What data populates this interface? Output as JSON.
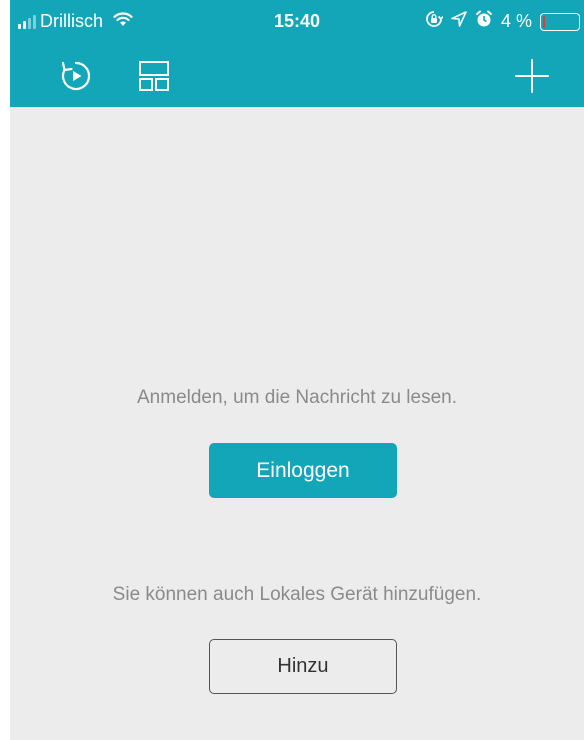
{
  "status_bar": {
    "carrier": "Drillisch",
    "time": "15:40",
    "battery_percent": "4 %",
    "battery_level": 0.04,
    "icons": [
      "signal-icon",
      "wifi-icon",
      "orientation-lock-icon",
      "location-arrow-icon",
      "alarm-icon",
      "battery-icon"
    ]
  },
  "toolbar": {
    "icons": [
      "replay-icon",
      "layout-grid-icon",
      "add-icon"
    ]
  },
  "main": {
    "login_prompt": "Anmelden, um die Nachricht zu lesen.",
    "login_button": "Einloggen",
    "local_prompt": "Sie können auch Lokales Gerät hinzufügen.",
    "add_button": "Hinzu"
  },
  "colors": {
    "accent": "#12a6b8",
    "background": "#ececec",
    "text_muted": "#8a8a8a",
    "battery_low": "#e53935"
  }
}
